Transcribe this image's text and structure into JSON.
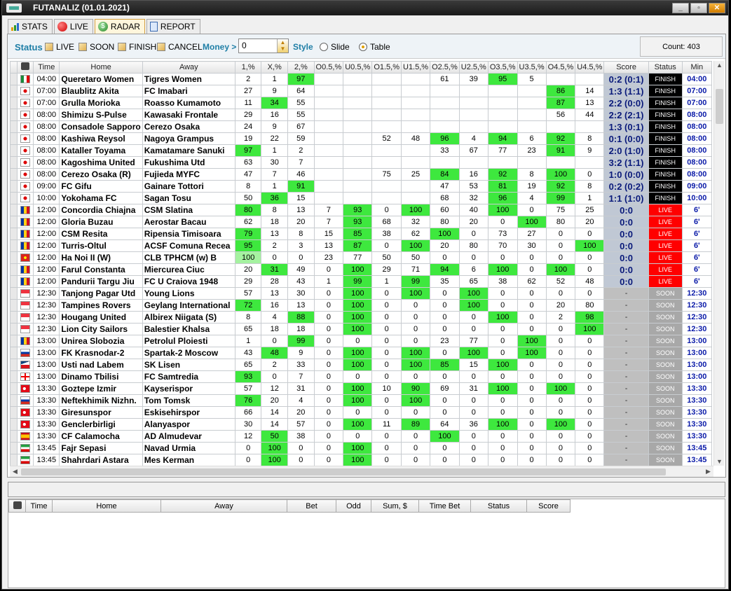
{
  "window": {
    "title": "FUTANALIZ (01.01.2021)"
  },
  "tabs": [
    {
      "label": "STATS"
    },
    {
      "label": "LIVE"
    },
    {
      "label": "RADAR"
    },
    {
      "label": "REPORT"
    }
  ],
  "colors": {
    "green": "#3ee83e",
    "light_green": "#a5f2a0",
    "live": "#ff0000",
    "finish": "#000000",
    "soon": "#a8a8a8",
    "score_text": "#0a1a7a",
    "min_text": "#0a1aa8",
    "accent": "#1e7ea6"
  },
  "toolbar": {
    "status_label": "Status",
    "live_label": "LIVE",
    "soon_label": "SOON",
    "finish_label": "FINISH",
    "cancel_label": "CANCEL",
    "money_label": "Money >",
    "money_value": "0",
    "style_label": "Style",
    "slide_label": "Slide",
    "table_label": "Table",
    "count": "Count: 403"
  },
  "columns": [
    "Time",
    "Home",
    "Away",
    "1,%",
    "X,%",
    "2,%",
    "O0.5,%",
    "U0.5,%",
    "O1.5,%",
    "U1.5,%",
    "O2.5,%",
    "U2.5,%",
    "O3.5,%",
    "U3.5,%",
    "O4.5,%",
    "U4.5,%",
    "Score",
    "Status",
    "Min"
  ],
  "rows": [
    {
      "flag": "mx",
      "time": "04:00",
      "home": "Queretaro Women",
      "away": "Tigres Women",
      "v": [
        "2",
        "1",
        "97",
        "",
        "",
        "",
        "",
        "61",
        "39",
        "95",
        "5",
        "",
        ""
      ],
      "g": [
        0,
        0,
        1,
        0,
        0,
        0,
        0,
        0,
        0,
        1,
        0,
        0,
        0
      ],
      "score": "0:2 (0:1)",
      "status": "FINISH",
      "min": "04:00"
    },
    {
      "flag": "jp",
      "time": "07:00",
      "home": "Blaublitz Akita",
      "away": "FC Imabari",
      "v": [
        "27",
        "9",
        "64",
        "",
        "",
        "",
        "",
        "",
        "",
        "",
        "",
        "86",
        "14"
      ],
      "g": [
        0,
        0,
        0,
        0,
        0,
        0,
        0,
        0,
        0,
        0,
        0,
        1,
        0
      ],
      "score": "1:3 (1:1)",
      "status": "FINISH",
      "min": "07:00"
    },
    {
      "flag": "jp",
      "time": "07:00",
      "home": "Grulla Morioka",
      "away": "Roasso Kumamoto",
      "v": [
        "11",
        "34",
        "55",
        "",
        "",
        "",
        "",
        "",
        "",
        "",
        "",
        "87",
        "13"
      ],
      "g": [
        0,
        1,
        0,
        0,
        0,
        0,
        0,
        0,
        0,
        0,
        0,
        1,
        0
      ],
      "score": "2:2 (0:0)",
      "status": "FINISH",
      "min": "07:00"
    },
    {
      "flag": "jp",
      "time": "08:00",
      "home": "Shimizu S-Pulse",
      "away": "Kawasaki Frontale",
      "v": [
        "29",
        "16",
        "55",
        "",
        "",
        "",
        "",
        "",
        "",
        "",
        "",
        "56",
        "44"
      ],
      "g": [
        0,
        0,
        0,
        0,
        0,
        0,
        0,
        0,
        0,
        0,
        0,
        0,
        0
      ],
      "score": "2:2 (2:1)",
      "status": "FINISH",
      "min": "08:00"
    },
    {
      "flag": "jp",
      "time": "08:00",
      "home": "Consadole Sapporo",
      "away": "Cerezo Osaka",
      "v": [
        "24",
        "9",
        "67",
        "",
        "",
        "",
        "",
        "",
        "",
        "",
        "",
        "",
        ""
      ],
      "g": [
        0,
        0,
        0,
        0,
        0,
        0,
        0,
        0,
        0,
        0,
        0,
        0,
        0
      ],
      "score": "1:3 (0:1)",
      "status": "FINISH",
      "min": "08:00"
    },
    {
      "flag": "jp",
      "time": "08:00",
      "home": "Kashiwa Reysol",
      "away": "Nagoya Grampus",
      "v": [
        "19",
        "22",
        "59",
        "",
        "",
        "52",
        "48",
        "96",
        "4",
        "94",
        "6",
        "92",
        "8"
      ],
      "g": [
        0,
        0,
        0,
        0,
        0,
        0,
        0,
        1,
        0,
        1,
        0,
        1,
        0
      ],
      "score": "0:1 (0:0)",
      "status": "FINISH",
      "min": "08:00"
    },
    {
      "flag": "jp",
      "time": "08:00",
      "home": "Kataller Toyama",
      "away": "Kamatamare Sanuki",
      "v": [
        "97",
        "1",
        "2",
        "",
        "",
        "",
        "",
        "33",
        "67",
        "77",
        "23",
        "91",
        "9"
      ],
      "g": [
        1,
        0,
        0,
        0,
        0,
        0,
        0,
        0,
        0,
        0,
        0,
        1,
        0
      ],
      "score": "2:0 (1:0)",
      "status": "FINISH",
      "min": "08:00"
    },
    {
      "flag": "jp",
      "time": "08:00",
      "home": "Kagoshima United",
      "away": "Fukushima Utd",
      "v": [
        "63",
        "30",
        "7",
        "",
        "",
        "",
        "",
        "",
        "",
        "",
        "",
        "",
        ""
      ],
      "g": [
        0,
        0,
        0,
        0,
        0,
        0,
        0,
        0,
        0,
        0,
        0,
        0,
        0
      ],
      "score": "3:2 (1:1)",
      "status": "FINISH",
      "min": "08:00"
    },
    {
      "flag": "jp",
      "time": "08:00",
      "home": "Cerezo Osaka (R)",
      "away": "Fujieda MYFC",
      "v": [
        "47",
        "7",
        "46",
        "",
        "",
        "75",
        "25",
        "84",
        "16",
        "92",
        "8",
        "100",
        "0"
      ],
      "g": [
        0,
        0,
        0,
        0,
        0,
        0,
        0,
        1,
        0,
        1,
        0,
        1,
        0
      ],
      "score": "1:0 (0:0)",
      "status": "FINISH",
      "min": "08:00"
    },
    {
      "flag": "jp",
      "time": "09:00",
      "home": "FC Gifu",
      "away": "Gainare Tottori",
      "v": [
        "8",
        "1",
        "91",
        "",
        "",
        "",
        "",
        "47",
        "53",
        "81",
        "19",
        "92",
        "8"
      ],
      "g": [
        0,
        0,
        1,
        0,
        0,
        0,
        0,
        0,
        0,
        1,
        0,
        1,
        0
      ],
      "score": "0:2 (0:2)",
      "status": "FINISH",
      "min": "09:00"
    },
    {
      "flag": "jp",
      "time": "10:00",
      "home": "Yokohama FC",
      "away": "Sagan Tosu",
      "v": [
        "50",
        "36",
        "15",
        "",
        "",
        "",
        "",
        "68",
        "32",
        "96",
        "4",
        "99",
        "1"
      ],
      "g": [
        0,
        1,
        0,
        0,
        0,
        0,
        0,
        0,
        0,
        1,
        0,
        1,
        0
      ],
      "score": "1:1 (1:0)",
      "status": "FINISH",
      "min": "10:00"
    },
    {
      "flag": "ro",
      "time": "12:00",
      "home": "Concordia Chiajna",
      "away": "CSM Slatina",
      "v": [
        "80",
        "8",
        "13",
        "7",
        "93",
        "0",
        "100",
        "60",
        "40",
        "100",
        "0",
        "75",
        "25"
      ],
      "g": [
        1,
        0,
        0,
        0,
        1,
        0,
        1,
        0,
        0,
        1,
        0,
        0,
        0
      ],
      "score": "0:0",
      "status": "LIVE",
      "min": "6'"
    },
    {
      "flag": "ro",
      "time": "12:00",
      "home": "Gloria Buzau",
      "away": "Aerostar Bacau",
      "v": [
        "62",
        "18",
        "20",
        "7",
        "93",
        "68",
        "32",
        "80",
        "20",
        "0",
        "100",
        "80",
        "20"
      ],
      "g": [
        0,
        0,
        0,
        0,
        1,
        0,
        0,
        0,
        0,
        0,
        1,
        0,
        0
      ],
      "score": "0:0",
      "status": "LIVE",
      "min": "6'"
    },
    {
      "flag": "ro",
      "time": "12:00",
      "home": "CSM Resita",
      "away": "Ripensia Timisoara",
      "v": [
        "79",
        "13",
        "8",
        "15",
        "85",
        "38",
        "62",
        "100",
        "0",
        "73",
        "27",
        "0",
        "0"
      ],
      "g": [
        1,
        0,
        0,
        0,
        1,
        0,
        0,
        1,
        0,
        0,
        0,
        0,
        0
      ],
      "score": "0:0",
      "status": "LIVE",
      "min": "6'"
    },
    {
      "flag": "ro",
      "time": "12:00",
      "home": "Turris-Oltul",
      "away": "ACSF Comuna Recea",
      "v": [
        "95",
        "2",
        "3",
        "13",
        "87",
        "0",
        "100",
        "20",
        "80",
        "70",
        "30",
        "0",
        "100"
      ],
      "g": [
        1,
        0,
        0,
        0,
        1,
        0,
        1,
        0,
        0,
        0,
        0,
        0,
        1
      ],
      "score": "0:0",
      "status": "LIVE",
      "min": "6'"
    },
    {
      "flag": "vn",
      "time": "12:00",
      "home": "Ha Noi II (W)",
      "away": "CLB TPHCM (w) B",
      "v": [
        "100",
        "0",
        "0",
        "23",
        "77",
        "50",
        "50",
        "0",
        "0",
        "0",
        "0",
        "0",
        "0"
      ],
      "g": [
        2,
        0,
        0,
        0,
        0,
        0,
        0,
        0,
        0,
        0,
        0,
        0,
        0
      ],
      "score": "0:0",
      "status": "LIVE",
      "min": "6'"
    },
    {
      "flag": "ro",
      "time": "12:00",
      "home": "Farul Constanta",
      "away": "Miercurea Ciuc",
      "v": [
        "20",
        "31",
        "49",
        "0",
        "100",
        "29",
        "71",
        "94",
        "6",
        "100",
        "0",
        "100",
        "0"
      ],
      "g": [
        0,
        1,
        0,
        0,
        1,
        0,
        0,
        1,
        0,
        1,
        0,
        1,
        0
      ],
      "score": "0:0",
      "status": "LIVE",
      "min": "6'"
    },
    {
      "flag": "ro",
      "time": "12:00",
      "home": "Pandurii Targu Jiu",
      "away": "FC U Craiova 1948",
      "v": [
        "29",
        "28",
        "43",
        "1",
        "99",
        "1",
        "99",
        "35",
        "65",
        "38",
        "62",
        "52",
        "48"
      ],
      "g": [
        0,
        0,
        0,
        0,
        1,
        0,
        1,
        0,
        0,
        0,
        0,
        0,
        0
      ],
      "score": "0:0",
      "status": "LIVE",
      "min": "6'"
    },
    {
      "flag": "sg",
      "time": "12:30",
      "home": "Tanjong Pagar Utd",
      "away": "Young Lions",
      "v": [
        "57",
        "13",
        "30",
        "0",
        "100",
        "0",
        "100",
        "0",
        "100",
        "0",
        "0",
        "0",
        "0"
      ],
      "g": [
        0,
        0,
        0,
        0,
        1,
        0,
        1,
        0,
        1,
        0,
        0,
        0,
        0
      ],
      "score": "-",
      "status": "SOON",
      "min": "12:30"
    },
    {
      "flag": "sg",
      "time": "12:30",
      "home": "Tampines Rovers",
      "away": "Geylang International",
      "v": [
        "72",
        "16",
        "13",
        "0",
        "100",
        "0",
        "0",
        "0",
        "100",
        "0",
        "0",
        "20",
        "80"
      ],
      "g": [
        1,
        0,
        0,
        0,
        1,
        0,
        0,
        0,
        1,
        0,
        0,
        0,
        0
      ],
      "score": "-",
      "status": "SOON",
      "min": "12:30"
    },
    {
      "flag": "sg",
      "time": "12:30",
      "home": "Hougang United",
      "away": "Albirex Niigata (S)",
      "v": [
        "8",
        "4",
        "88",
        "0",
        "100",
        "0",
        "0",
        "0",
        "0",
        "100",
        "0",
        "2",
        "98"
      ],
      "g": [
        0,
        0,
        1,
        0,
        1,
        0,
        0,
        0,
        0,
        1,
        0,
        0,
        1
      ],
      "score": "-",
      "status": "SOON",
      "min": "12:30"
    },
    {
      "flag": "sg",
      "time": "12:30",
      "home": "Lion City Sailors",
      "away": "Balestier Khalsa",
      "v": [
        "65",
        "18",
        "18",
        "0",
        "100",
        "0",
        "0",
        "0",
        "0",
        "0",
        "0",
        "0",
        "100"
      ],
      "g": [
        0,
        0,
        0,
        0,
        1,
        0,
        0,
        0,
        0,
        0,
        0,
        0,
        1
      ],
      "score": "-",
      "status": "SOON",
      "min": "12:30"
    },
    {
      "flag": "ro",
      "time": "13:00",
      "home": "Unirea Slobozia",
      "away": "Petrolul Ploiesti",
      "v": [
        "1",
        "0",
        "99",
        "0",
        "0",
        "0",
        "0",
        "23",
        "77",
        "0",
        "100",
        "0",
        "0"
      ],
      "g": [
        0,
        0,
        1,
        0,
        0,
        0,
        0,
        0,
        0,
        0,
        1,
        0,
        0
      ],
      "score": "-",
      "status": "SOON",
      "min": "13:00"
    },
    {
      "flag": "ru",
      "time": "13:00",
      "home": "FK Krasnodar-2",
      "away": "Spartak-2 Moscow",
      "v": [
        "43",
        "48",
        "9",
        "0",
        "100",
        "0",
        "100",
        "0",
        "100",
        "0",
        "100",
        "0",
        "0"
      ],
      "g": [
        0,
        1,
        0,
        0,
        1,
        0,
        1,
        0,
        1,
        0,
        1,
        0,
        0
      ],
      "score": "-",
      "status": "SOON",
      "min": "13:00"
    },
    {
      "flag": "cz",
      "time": "13:00",
      "home": "Usti nad Labem",
      "away": "SK Lisen",
      "v": [
        "65",
        "2",
        "33",
        "0",
        "100",
        "0",
        "100",
        "85",
        "15",
        "100",
        "0",
        "0",
        "0"
      ],
      "g": [
        0,
        0,
        0,
        0,
        1,
        0,
        1,
        1,
        0,
        1,
        0,
        0,
        0
      ],
      "score": "-",
      "status": "SOON",
      "min": "13:00"
    },
    {
      "flag": "ge",
      "time": "13:00",
      "home": "Dinamo Tbilisi",
      "away": "FC Samtredia",
      "v": [
        "93",
        "0",
        "7",
        "0",
        "0",
        "0",
        "0",
        "0",
        "0",
        "0",
        "0",
        "0",
        "0"
      ],
      "g": [
        1,
        0,
        0,
        0,
        0,
        0,
        0,
        0,
        0,
        0,
        0,
        0,
        0
      ],
      "score": "-",
      "status": "SOON",
      "min": "13:00"
    },
    {
      "flag": "tr",
      "time": "13:30",
      "home": "Goztepe Izmir",
      "away": "Kayserispor",
      "v": [
        "57",
        "12",
        "31",
        "0",
        "100",
        "10",
        "90",
        "69",
        "31",
        "100",
        "0",
        "100",
        "0"
      ],
      "g": [
        0,
        0,
        0,
        0,
        1,
        0,
        1,
        0,
        0,
        1,
        0,
        1,
        0
      ],
      "score": "-",
      "status": "SOON",
      "min": "13:30"
    },
    {
      "flag": "ru",
      "time": "13:30",
      "home": "Neftekhimik Nizhn.",
      "away": "Tom Tomsk",
      "v": [
        "76",
        "20",
        "4",
        "0",
        "100",
        "0",
        "100",
        "0",
        "0",
        "0",
        "0",
        "0",
        "0"
      ],
      "g": [
        1,
        0,
        0,
        0,
        1,
        0,
        1,
        0,
        0,
        0,
        0,
        0,
        0
      ],
      "score": "-",
      "status": "SOON",
      "min": "13:30"
    },
    {
      "flag": "tr",
      "time": "13:30",
      "home": "Giresunspor",
      "away": "Eskisehirspor",
      "v": [
        "66",
        "14",
        "20",
        "0",
        "0",
        "0",
        "0",
        "0",
        "0",
        "0",
        "0",
        "0",
        "0"
      ],
      "g": [
        0,
        0,
        0,
        0,
        0,
        0,
        0,
        0,
        0,
        0,
        0,
        0,
        0
      ],
      "score": "-",
      "status": "SOON",
      "min": "13:30"
    },
    {
      "flag": "tr",
      "time": "13:30",
      "home": "Genclerbirligi",
      "away": "Alanyaspor",
      "v": [
        "30",
        "14",
        "57",
        "0",
        "100",
        "11",
        "89",
        "64",
        "36",
        "100",
        "0",
        "100",
        "0"
      ],
      "g": [
        0,
        0,
        0,
        0,
        1,
        0,
        1,
        0,
        0,
        1,
        0,
        1,
        0
      ],
      "score": "-",
      "status": "SOON",
      "min": "13:30"
    },
    {
      "flag": "es",
      "time": "13:30",
      "home": "CF Calamocha",
      "away": "AD Almudevar",
      "v": [
        "12",
        "50",
        "38",
        "0",
        "0",
        "0",
        "0",
        "100",
        "0",
        "0",
        "0",
        "0",
        "0"
      ],
      "g": [
        0,
        1,
        0,
        0,
        0,
        0,
        0,
        1,
        0,
        0,
        0,
        0,
        0
      ],
      "score": "-",
      "status": "SOON",
      "min": "13:30"
    },
    {
      "flag": "ir",
      "time": "13:45",
      "home": "Fajr Sepasi",
      "away": "Navad Urmia",
      "v": [
        "0",
        "100",
        "0",
        "0",
        "100",
        "0",
        "0",
        "0",
        "0",
        "0",
        "0",
        "0",
        "0"
      ],
      "g": [
        0,
        1,
        0,
        0,
        1,
        0,
        0,
        0,
        0,
        0,
        0,
        0,
        0
      ],
      "score": "-",
      "status": "SOON",
      "min": "13:45"
    },
    {
      "flag": "ir",
      "time": "13:45",
      "home": "Shahrdari Astara",
      "away": "Mes Kerman",
      "v": [
        "0",
        "100",
        "0",
        "0",
        "100",
        "0",
        "0",
        "0",
        "0",
        "0",
        "0",
        "0",
        "0"
      ],
      "g": [
        0,
        1,
        0,
        0,
        1,
        0,
        0,
        0,
        0,
        0,
        0,
        0,
        0
      ],
      "score": "-",
      "status": "SOON",
      "min": "13:45"
    }
  ],
  "bets": {
    "columns": [
      "Time",
      "Home",
      "Away",
      "Bet",
      "Odd",
      "Sum, $",
      "Time Bet",
      "Status",
      "Score"
    ]
  }
}
